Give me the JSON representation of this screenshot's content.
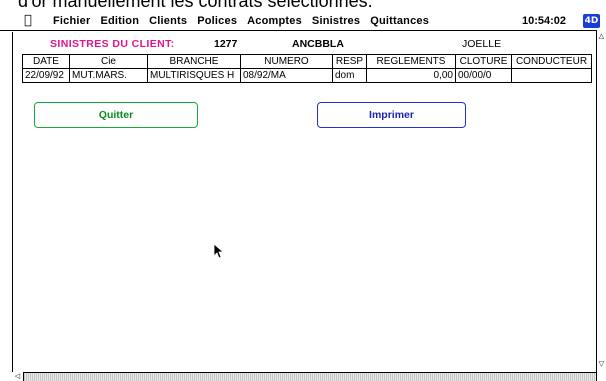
{
  "caption": {
    "text": "d'or manuellement les contrats sélectionnés."
  },
  "menubar": {
    "apple_icon": "apple-icon",
    "items": [
      "Fichier",
      "Edition",
      "Clients",
      "Polices",
      "Acomptes",
      "Sinistres",
      "Quittances"
    ],
    "clock": "10:54:02",
    "app_icon_label": "4D"
  },
  "header": {
    "title": "SINISTRES DU CLIENT:",
    "client_number": "1277",
    "client_code": "ANCBBLA",
    "user": "JOELLE",
    "title_color": "#e0158b"
  },
  "table": {
    "columns": [
      "DATE",
      "Cie",
      "BRANCHE",
      "NUMERO",
      "RESP",
      "REGLEMENTS",
      "CLOTURE",
      "CONDUCTEUR"
    ],
    "rows": [
      [
        "22/09/92",
        "MUT.MARS.",
        "MULTIRISQUES H",
        "08/92/MA",
        "dom",
        "0,00",
        "00/00/0",
        ""
      ]
    ]
  },
  "buttons": {
    "quit_label": "Quitter",
    "print_label": "Imprimer",
    "quit_color": "#0a8a1e",
    "print_color": "#1a22b4"
  }
}
